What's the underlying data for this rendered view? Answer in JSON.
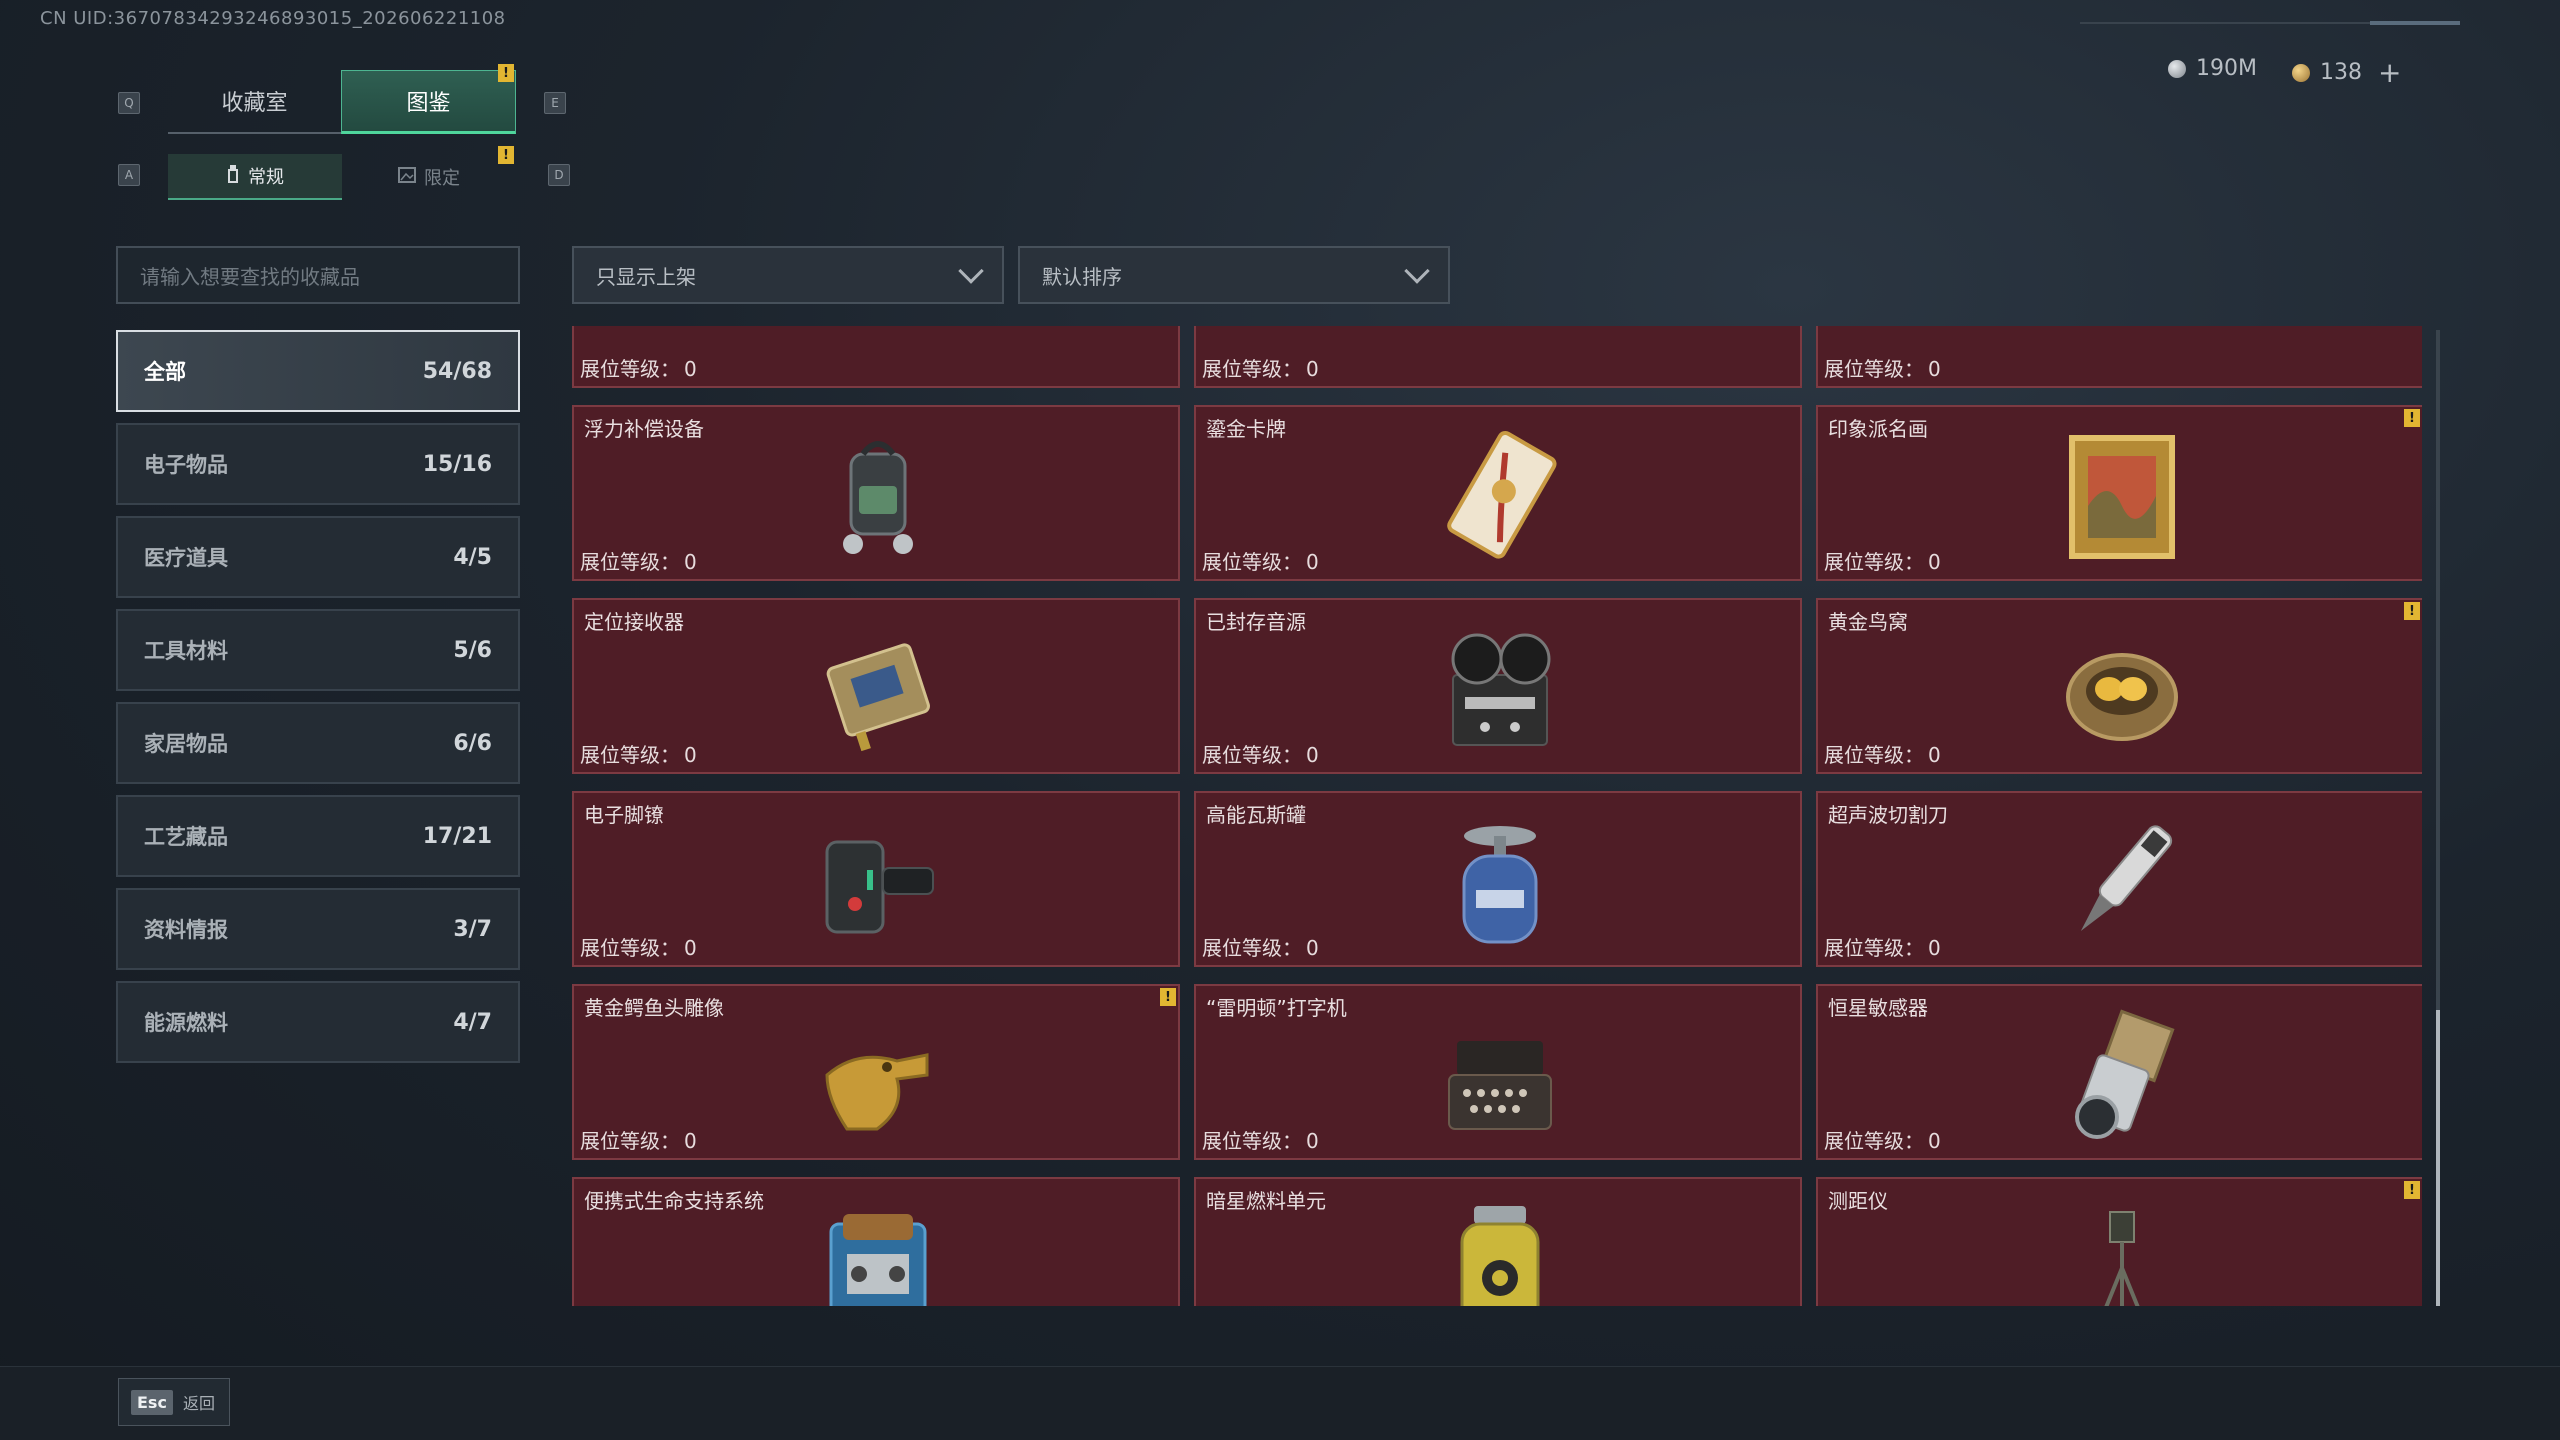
{
  "header": {
    "uid": "CN UID:367078342932468930​15_202606221108",
    "currency_silver": "190M",
    "currency_gold": "138",
    "add_label": "+"
  },
  "tabs": [
    {
      "label": "收藏室",
      "key": "Q"
    },
    {
      "label": "图鉴",
      "key": "E",
      "active": true
    }
  ],
  "subtabs": [
    {
      "label": "常规",
      "key": "A",
      "active": true
    },
    {
      "label": "限定",
      "key": "D"
    }
  ],
  "search": {
    "placeholder": "请输入想要查找的收藏品"
  },
  "filters": {
    "shelf": "只显示上架",
    "sort": "默认排序"
  },
  "categories": [
    {
      "label": "全部",
      "count": "54/68",
      "active": true
    },
    {
      "label": "电子物品",
      "count": "15/16"
    },
    {
      "label": "医疗道具",
      "count": "4/5"
    },
    {
      "label": "工具材料",
      "count": "5/6"
    },
    {
      "label": "家居物品",
      "count": "6/6"
    },
    {
      "label": "工艺藏品",
      "count": "17/21"
    },
    {
      "label": "资料情报",
      "count": "3/7"
    },
    {
      "label": "能源燃料",
      "count": "4/7"
    }
  ],
  "level_label": "展位等级：",
  "items": [
    {
      "name": "",
      "level": "0",
      "alert": false,
      "icon": "partial-item"
    },
    {
      "name": "",
      "level": "0",
      "alert": false,
      "icon": "partial-item"
    },
    {
      "name": "",
      "level": "0",
      "alert": false,
      "icon": "partial-item"
    },
    {
      "name": "浮力补偿设备",
      "level": "0",
      "alert": false,
      "icon": "buoyancy-device-icon"
    },
    {
      "name": "鎏金卡牌",
      "level": "0",
      "alert": false,
      "icon": "gilded-card-icon"
    },
    {
      "name": "印象派名画",
      "level": "0",
      "alert": true,
      "icon": "painting-icon"
    },
    {
      "name": "定位接收器",
      "level": "0",
      "alert": false,
      "icon": "receiver-icon"
    },
    {
      "name": "已封存音源",
      "level": "0",
      "alert": false,
      "icon": "tape-recorder-icon"
    },
    {
      "name": "黄金鸟窝",
      "level": "0",
      "alert": true,
      "icon": "golden-nest-icon"
    },
    {
      "name": "电子脚镣",
      "level": "0",
      "alert": false,
      "icon": "ankle-monitor-icon"
    },
    {
      "name": "高能瓦斯罐",
      "level": "0",
      "alert": false,
      "icon": "gas-canister-icon"
    },
    {
      "name": "超声波切割刀",
      "level": "0",
      "alert": false,
      "icon": "ultrasonic-cutter-icon"
    },
    {
      "name": "黄金鳄鱼头雕像",
      "level": "0",
      "alert": true,
      "icon": "croc-statue-icon"
    },
    {
      "name": "“雷明顿”打字机",
      "level": "0",
      "alert": false,
      "icon": "typewriter-icon"
    },
    {
      "name": "恒星敏感器",
      "level": "0",
      "alert": false,
      "icon": "star-sensor-icon"
    },
    {
      "name": "便携式生命支持系统",
      "level": "0",
      "alert": false,
      "icon": "life-support-icon"
    },
    {
      "name": "暗星燃料单元",
      "level": "0",
      "alert": false,
      "icon": "fuel-cell-icon"
    },
    {
      "name": "测距仪",
      "level": "0",
      "alert": true,
      "icon": "rangefinder-icon"
    }
  ],
  "footer": {
    "esc_key": "Esc",
    "esc_label": "返回"
  },
  "colors": {
    "card_bg": "#4f1d26",
    "card_border": "#7c3a42",
    "accent": "#4fd69c",
    "alert": "#e2b632"
  }
}
